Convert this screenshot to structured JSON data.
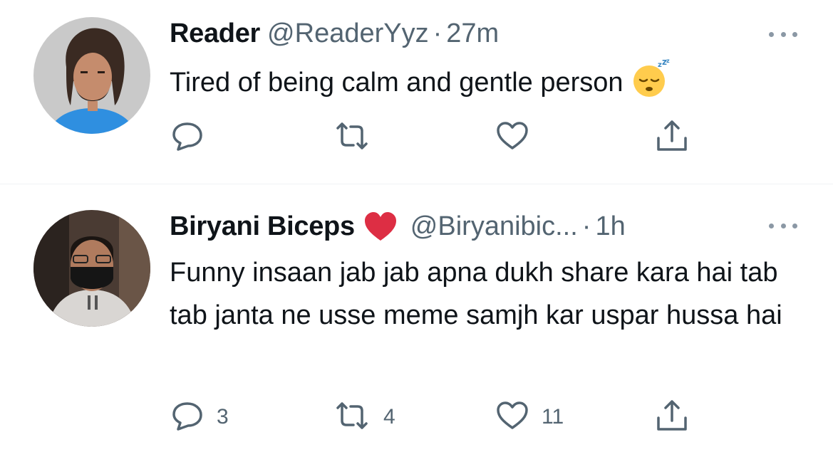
{
  "tweets": [
    {
      "name": "Reader",
      "handle": "@ReaderYyz",
      "separator": "·",
      "time": "27m",
      "text": "Tired of being calm and gentle person",
      "emoji": "sleeping-face",
      "counts": {
        "reply": "",
        "retweet": "",
        "like": ""
      }
    },
    {
      "name": "Biryani Biceps",
      "name_badge": "red-heart",
      "handle": "@Biryanibic...",
      "separator": "·",
      "time": "1h",
      "text": "Funny insaan jab jab apna dukh share kara hai tab tab janta ne usse meme samjh kar uspar hussa hai",
      "counts": {
        "reply": "3",
        "retweet": "4",
        "like": "11"
      }
    }
  ],
  "icons": [
    "reply-icon",
    "retweet-icon",
    "like-icon",
    "share-icon",
    "more-icon"
  ],
  "colors": {
    "text": "#0f1419",
    "secondary": "#536471",
    "divider": "#eff3f4",
    "heart": "#dd2e44"
  }
}
